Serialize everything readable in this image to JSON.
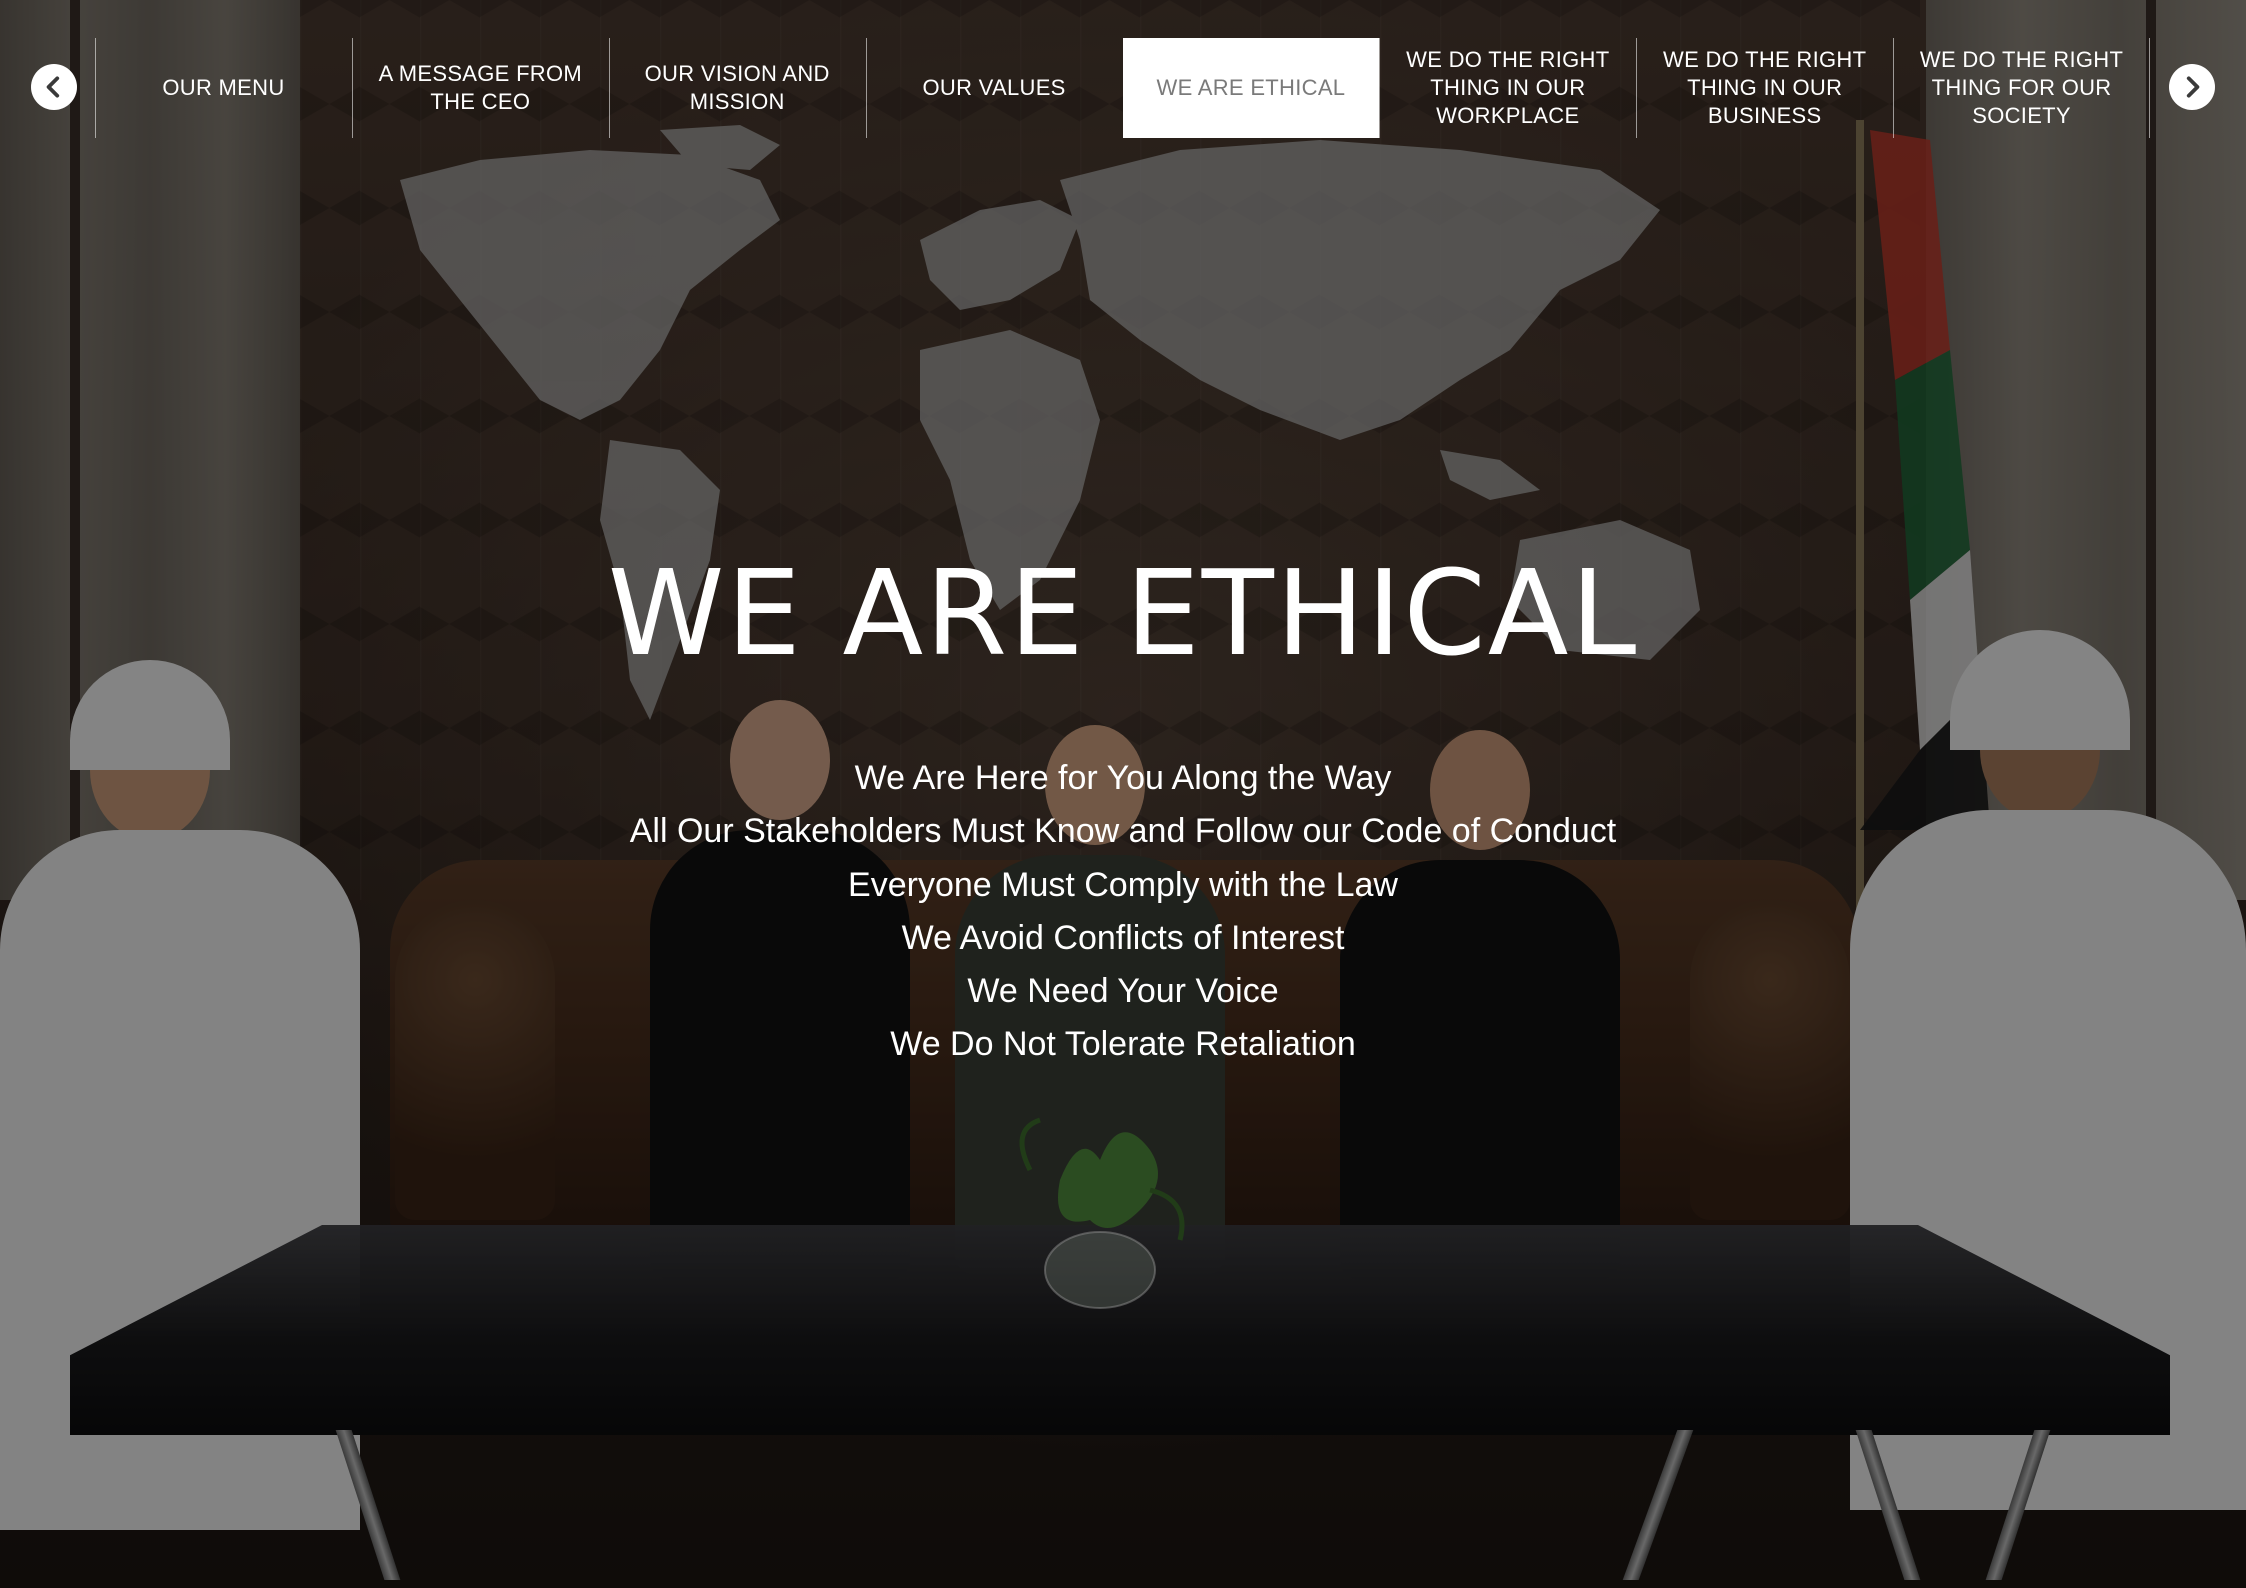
{
  "nav": {
    "prev_icon": "chevron-left-icon",
    "next_icon": "chevron-right-icon",
    "items": [
      {
        "label": "OUR MENU",
        "active": false
      },
      {
        "label": "A MESSAGE FROM THE CEO",
        "active": false
      },
      {
        "label": "OUR VISION AND MISSION",
        "active": false
      },
      {
        "label": "OUR VALUES",
        "active": false
      },
      {
        "label": "WE ARE ETHICAL",
        "active": true
      },
      {
        "label": "WE DO THE RIGHT THING IN OUR WORKPLACE",
        "active": false
      },
      {
        "label": "WE DO THE RIGHT THING IN OUR BUSINESS",
        "active": false
      },
      {
        "label": "WE DO THE RIGHT THING FOR OUR SOCIETY",
        "active": false
      }
    ]
  },
  "hero": {
    "title": "WE ARE ETHICAL",
    "lines": [
      "We Are Here for You Along the Way",
      "All Our Stakeholders Must Know and Follow our Code of Conduct",
      "Everyone  Must Comply with the Law",
      "We Avoid Conflicts of Interest",
      "We Need Your Voice",
      "We Do Not Tolerate Retaliation"
    ]
  },
  "colors": {
    "active_tab_bg": "#ffffff",
    "active_tab_text": "#7a7a7a",
    "nav_text": "#ffffff",
    "overlay": "rgba(0,0,0,0.45)"
  }
}
